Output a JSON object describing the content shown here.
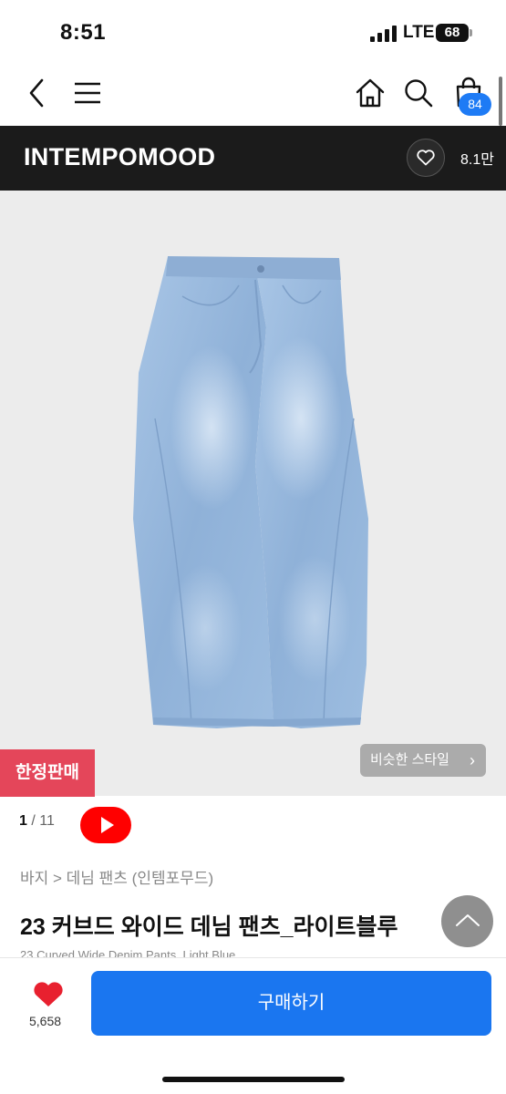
{
  "status_bar": {
    "time": "8:51",
    "network": "LTE",
    "battery": "68"
  },
  "nav": {
    "back_icon": "chevron-left-icon",
    "menu_icon": "hamburger-icon",
    "home_icon": "home-icon",
    "search_icon": "search-icon",
    "cart_icon": "shopping-bag-icon",
    "cart_count": "84"
  },
  "brand": {
    "name": "INTEMPOMOOD",
    "like_count": "8.1만"
  },
  "product": {
    "limited_label": "한정판매",
    "similar_style_label": "비슷한 스타일",
    "current_image": "1",
    "total_images": "11",
    "breadcrumb": "바지 > 데님 팬츠 (인템포무드)",
    "title_kr": "23 커브드 와이드 데님 팬츠_라이트블루",
    "title_en": "23 Curved Wide Denim Pants_Light Blue"
  },
  "bottom": {
    "like_count": "5,658",
    "buy_label": "구매하기"
  },
  "colors": {
    "accent": "#1a76f0",
    "limited": "#e4465a",
    "brand_bar": "#1b1b1b",
    "heart": "#e8202f"
  }
}
